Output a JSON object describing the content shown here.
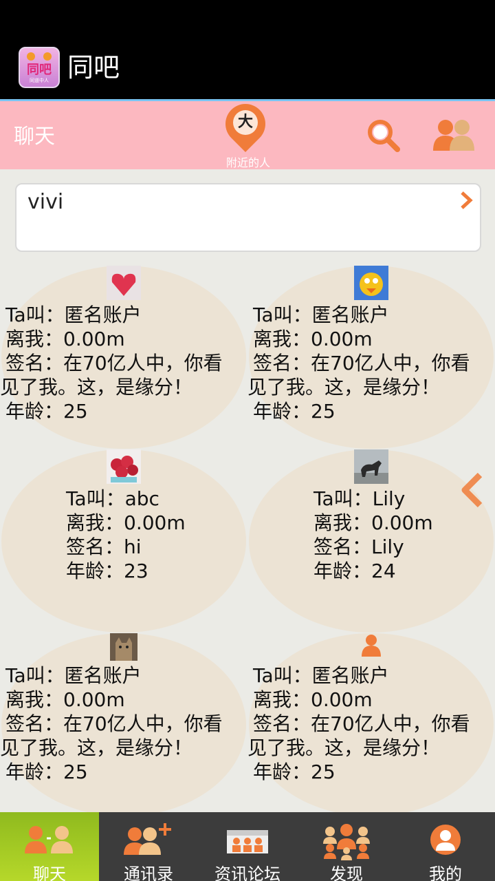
{
  "app": {
    "title": "同吧",
    "logo_text": "同吧",
    "logo_sub": "同道中人"
  },
  "toolbar": {
    "chat_label": "聊天",
    "nearby_icon_char": "大",
    "nearby_label": "附近的人"
  },
  "search": {
    "value": "vivi"
  },
  "cards": [
    {
      "avatar": "strawberry-heart-avatar",
      "name": "Ta叫：匿名账户",
      "distance": "离我：0.00m",
      "sign1": "签名：在70亿人中，你看",
      "sign2": "见了我。这，是缘分！",
      "age": "年龄：25"
    },
    {
      "avatar": "cartoon-bird-avatar",
      "name": "Ta叫：匿名账户",
      "distance": "离我：0.00m",
      "sign1": "签名：在70亿人中，你看",
      "sign2": "见了我。这，是缘分！",
      "age": "年龄：25"
    },
    {
      "avatar": "lychee-avatar",
      "name": "Ta叫：abc",
      "distance": "离我：0.00m",
      "sign": "签名：hi",
      "age": "年龄：23"
    },
    {
      "avatar": "dog-photo-avatar",
      "name": "Ta叫：Lily",
      "distance": "离我：0.00m",
      "sign": "签名：Lily",
      "age": "年龄：24"
    },
    {
      "avatar": "cat-photo-avatar",
      "name": "Ta叫：匿名账户",
      "distance": "离我：0.00m",
      "sign1": "签名：在70亿人中，你看",
      "sign2": "见了我。这，是缘分！",
      "age": "年龄：25"
    },
    {
      "avatar": "default-person-avatar",
      "name": "Ta叫：匿名账户",
      "distance": "离我：0.00m",
      "sign1": "签名：在70亿人中，你看",
      "sign2": "见了我。这，是缘分！",
      "age": "年龄：25"
    }
  ],
  "nav": [
    {
      "label": "聊天",
      "icon": "chat-people-icon",
      "active": true
    },
    {
      "label": "通讯录",
      "icon": "add-contact-icon",
      "active": false
    },
    {
      "label": "资讯论坛",
      "icon": "forum-icon",
      "active": false
    },
    {
      "label": "发现",
      "icon": "discover-group-icon",
      "active": false
    },
    {
      "label": "我的",
      "icon": "profile-icon",
      "active": false
    }
  ],
  "colors": {
    "toolbar": "#fcb8c0",
    "accent": "#f07c3a",
    "nav_active": "#9cc524",
    "card_bg": "#ece3d4"
  }
}
